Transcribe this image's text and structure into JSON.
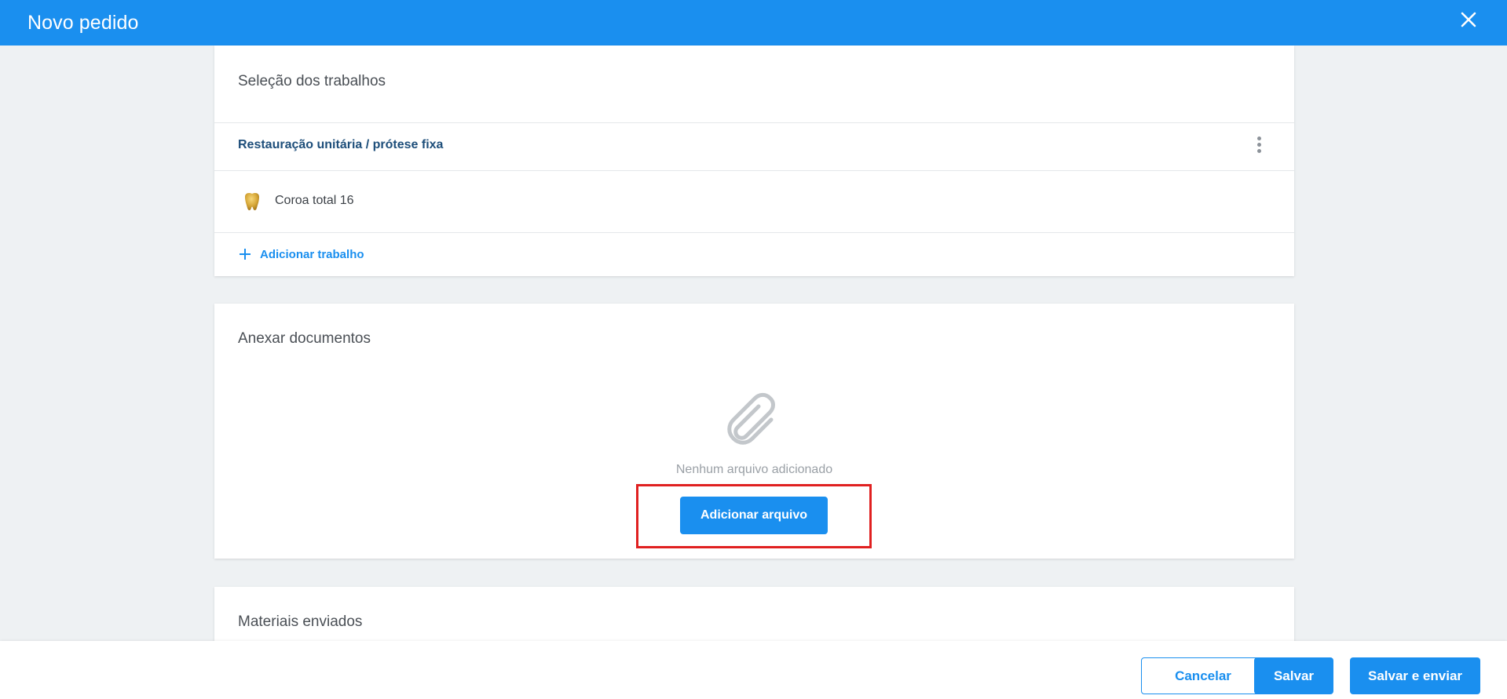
{
  "header": {
    "title": "Novo pedido",
    "close_icon": "close-icon",
    "background_color": "#1a8fef"
  },
  "jobs_section": {
    "title": "Seleção dos trabalhos",
    "group_label": "Restauração unitária / prótese fixa",
    "group_menu_icon": "more-vertical-icon",
    "items": [
      {
        "label": "Coroa total 16",
        "icon": "tooth-icon"
      }
    ],
    "add_job_label": "Adicionar trabalho",
    "add_job_icon": "plus-icon"
  },
  "documents_section": {
    "title": "Anexar documentos",
    "empty_icon": "paperclip-icon",
    "empty_text": "Nenhum arquivo adicionado",
    "add_file_label": "Adicionar arquivo"
  },
  "materials_section": {
    "title": "Materiais enviados"
  },
  "footer": {
    "cancel_label": "Cancelar",
    "save_label": "Salvar",
    "save_send_label": "Salvar e enviar"
  },
  "colors": {
    "accent": "#1a8fef",
    "highlight": "#e02020",
    "group_label": "#1d4e7a"
  }
}
